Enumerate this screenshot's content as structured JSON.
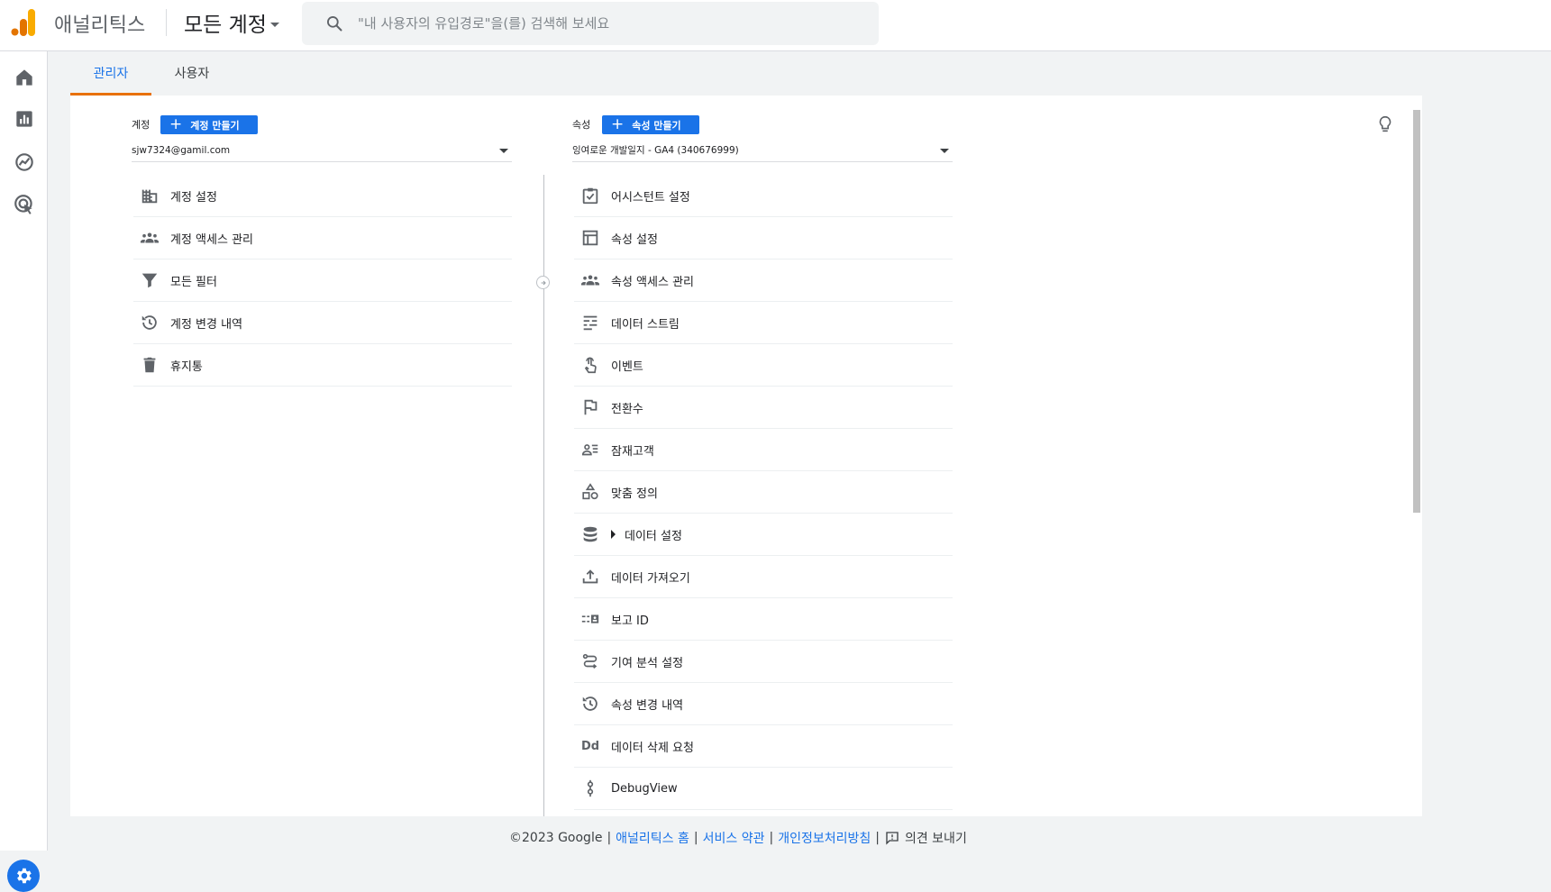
{
  "header": {
    "app_name": "애널리틱스",
    "account_switcher": "모든 계정",
    "search_placeholder": "\"내 사용자의 유입경로\"을(를) 검색해 보세요"
  },
  "tabs": [
    {
      "label": "관리자",
      "active": true
    },
    {
      "label": "사용자",
      "active": false
    }
  ],
  "account_column": {
    "label": "계정",
    "create_button": "계정 만들기",
    "selected_account": "sjw7324@gamil.com",
    "items": [
      {
        "label": "계정 설정",
        "icon": "building-icon"
      },
      {
        "label": "계정 액세스 관리",
        "icon": "people-icon"
      },
      {
        "label": "모든 필터",
        "icon": "filter-icon"
      },
      {
        "label": "계정 변경 내역",
        "icon": "history-icon"
      },
      {
        "label": "휴지통",
        "icon": "trash-icon"
      }
    ]
  },
  "property_column": {
    "label": "속성",
    "create_button": "속성 만들기",
    "selected_property": "잉여로운 개발일지 - GA4 (340676999)",
    "items": [
      {
        "label": "어시스턴트 설정",
        "icon": "checklist-icon"
      },
      {
        "label": "속성 설정",
        "icon": "layout-icon"
      },
      {
        "label": "속성 액세스 관리",
        "icon": "people-icon"
      },
      {
        "label": "데이터 스트림",
        "icon": "stream-icon"
      },
      {
        "label": "이벤트",
        "icon": "touch-icon"
      },
      {
        "label": "전환수",
        "icon": "flag-icon"
      },
      {
        "label": "잠재고객",
        "icon": "audience-icon"
      },
      {
        "label": "맞춤 정의",
        "icon": "shapes-icon"
      },
      {
        "label": "데이터 설정",
        "icon": "database-icon"
      },
      {
        "label": "데이터 가져오기",
        "icon": "upload-icon"
      },
      {
        "label": "보고 ID",
        "icon": "report-id-icon"
      },
      {
        "label": "기여 분석 설정",
        "icon": "attribution-icon"
      },
      {
        "label": "속성 변경 내역",
        "icon": "history-icon"
      },
      {
        "label": "데이터 삭제 요청",
        "icon": "dd-icon"
      },
      {
        "label": "DebugView",
        "icon": "debug-icon"
      }
    ]
  },
  "footer": {
    "copyright": "©2023 Google",
    "link_home": "애널리틱스 홈",
    "link_terms": "서비스 약관",
    "link_privacy": "개인정보처리방침",
    "feedback": "의견 보내기"
  },
  "colors": {
    "accent": "#1a73e8",
    "tab_indicator": "#e8710a",
    "logo_orange": "#f9ab00",
    "logo_dark_orange": "#e37400"
  }
}
